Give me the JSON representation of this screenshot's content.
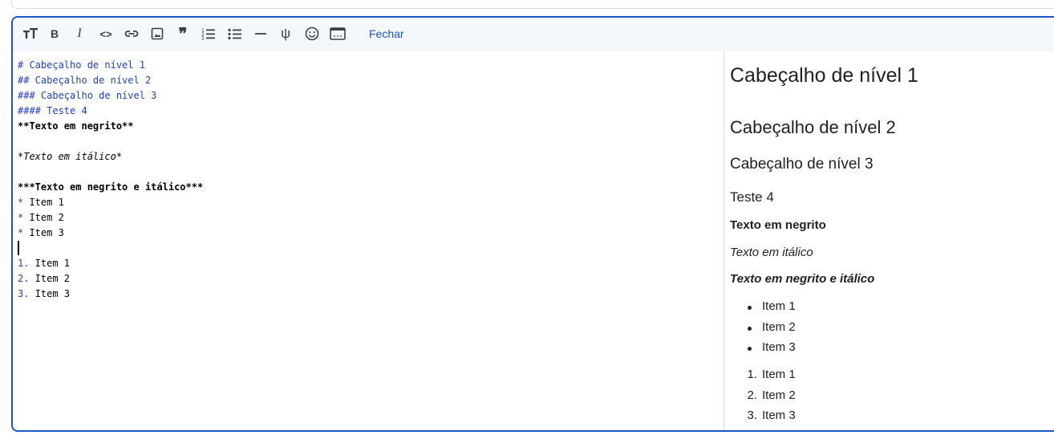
{
  "toolbar": {
    "icons": [
      "text-size-icon",
      "bold-icon",
      "italic-icon",
      "code-icon",
      "link-icon",
      "image-icon",
      "quote-icon",
      "numbered-list-icon",
      "bulleted-list-icon",
      "horizontal-rule-icon",
      "psi-icon",
      "emoji-icon",
      "embed-icon"
    ],
    "bold_glyph": "B",
    "italic_glyph": "I",
    "code_glyph": "<>",
    "quote_glyph": "❞",
    "psi_glyph": "ψ",
    "close_label": "Fechar"
  },
  "source": {
    "lines": [
      {
        "marker": "#",
        "text": " Cabeçalho de nível 1"
      },
      {
        "marker": "##",
        "text": " Cabeçalho de nível 2"
      },
      {
        "marker": "###",
        "text": " Cabeçalho de nível 3"
      },
      {
        "marker": "####",
        "text": " Teste 4"
      },
      {
        "bold": "**Texto em negrito**"
      },
      {
        "blank": ""
      },
      {
        "italic": "*Texto em itálico*"
      },
      {
        "blank": ""
      },
      {
        "bold": "***Texto em negrito e itálico***"
      },
      {
        "marker": "*",
        "text": " Item 1"
      },
      {
        "marker": "*",
        "text": " Item 2"
      },
      {
        "marker": "*",
        "text": " Item 3"
      },
      {
        "blank": ""
      },
      {
        "marker": "1.",
        "text": " Item 1"
      },
      {
        "marker": "2.",
        "text": " Item 2"
      },
      {
        "marker": "3.",
        "text": " Item 3"
      }
    ]
  },
  "preview": {
    "h1": "Cabeçalho de nível 1",
    "h2": "Cabeçalho de nível 2",
    "h3": "Cabeçalho de nível 3",
    "h4": "Teste 4",
    "bold": "Texto em negrito",
    "italic": "Texto em itálico",
    "bold_italic": "Texto em negrito e itálico",
    "bullets": [
      "Item 1",
      "Item 2",
      "Item 3"
    ],
    "numbered": [
      {
        "n": "1.",
        "text": "Item 1"
      },
      {
        "n": "2.",
        "text": "Item 2"
      },
      {
        "n": "3.",
        "text": "Item 3"
      }
    ]
  },
  "colors": {
    "accent": "#1a57c0",
    "markdown_marker": "#1f3fce",
    "toolbar_bg": "#f4f7fc"
  }
}
